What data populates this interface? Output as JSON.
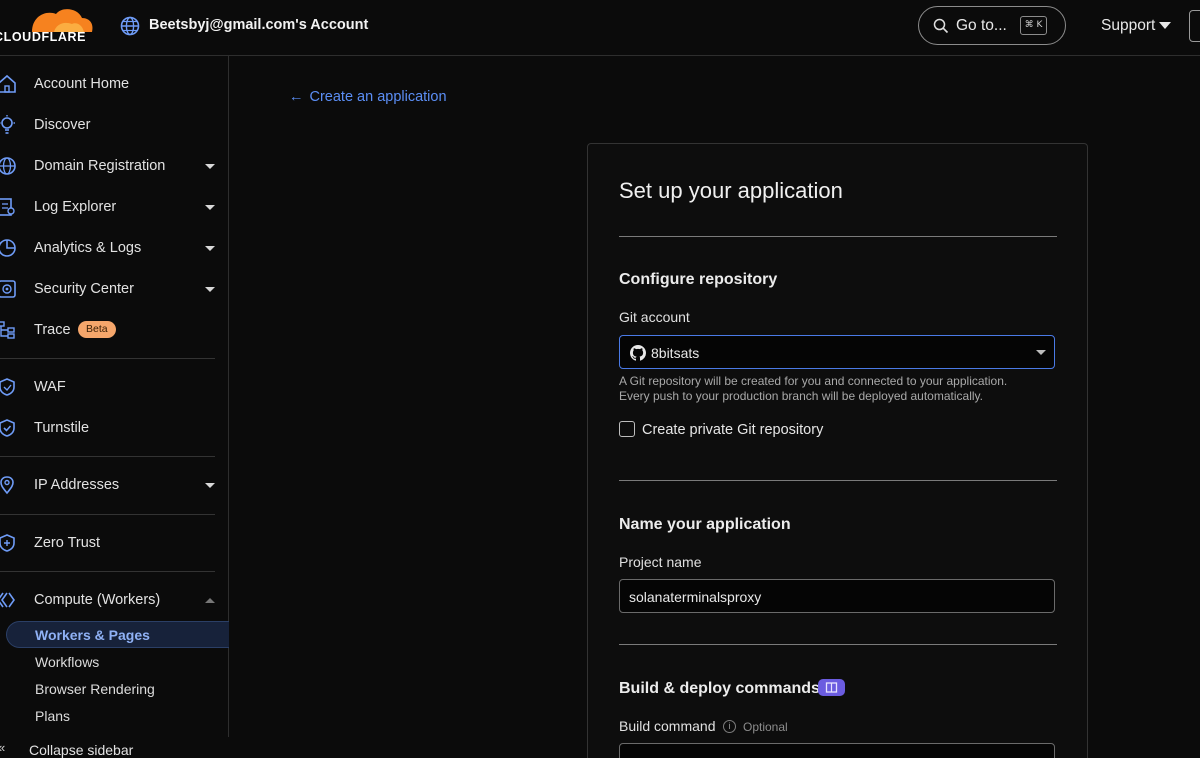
{
  "topbar": {
    "logo_text": "CLOUDFLARE",
    "account_label": "Beetsbyj@gmail.com's Account",
    "goto_label": "Go to...",
    "goto_shortcut": "⌘ K",
    "support_label": "Support"
  },
  "sidebar": {
    "items": [
      {
        "label": "Account Home",
        "icon": "home-icon"
      },
      {
        "label": "Discover",
        "icon": "lightbulb-icon"
      },
      {
        "label": "Domain Registration",
        "icon": "globe-icon",
        "expandable": true
      },
      {
        "label": "Log Explorer",
        "icon": "log-icon",
        "expandable": true
      },
      {
        "label": "Analytics & Logs",
        "icon": "chart-icon",
        "expandable": true
      },
      {
        "label": "Security Center",
        "icon": "security-icon",
        "expandable": true
      },
      {
        "label": "Trace",
        "icon": "trace-icon",
        "badge": "Beta"
      },
      {
        "label": "WAF",
        "icon": "shield-icon"
      },
      {
        "label": "Turnstile",
        "icon": "turnstile-icon"
      },
      {
        "label": "IP Addresses",
        "icon": "location-pin-icon",
        "expandable": true
      },
      {
        "label": "Zero Trust",
        "icon": "zero-trust-icon"
      },
      {
        "label": "Compute (Workers)",
        "icon": "workers-icon",
        "expandable": true,
        "expanded": true
      }
    ],
    "sub_items": [
      {
        "label": "Workers & Pages",
        "active": true
      },
      {
        "label": "Workflows"
      },
      {
        "label": "Browser Rendering"
      },
      {
        "label": "Plans"
      }
    ],
    "collapse_label": "Collapse sidebar"
  },
  "main": {
    "back_link": "Create an application",
    "panel_title": "Set up your application",
    "configure": {
      "title": "Configure repository",
      "git_account_label": "Git account",
      "git_account_value": "8bitsats",
      "help_line1": "A Git repository will be created for you and connected to your application.",
      "help_line2": "Every push to your production branch will be deployed automatically.",
      "private_repo_label": "Create private Git repository",
      "private_repo_checked": false
    },
    "name": {
      "title": "Name your application",
      "project_label": "Project name",
      "project_value": "solanaterminalsproxy"
    },
    "build": {
      "title": "Build & deploy commands",
      "build_command_label": "Build command",
      "optional_label": "Optional",
      "build_command_value": ""
    }
  },
  "colors": {
    "accent": "#5b8ef5",
    "brand_orange": "#f6821f",
    "badge_orange": "#f5a66b",
    "docs_badge": "#6b5ce0"
  }
}
